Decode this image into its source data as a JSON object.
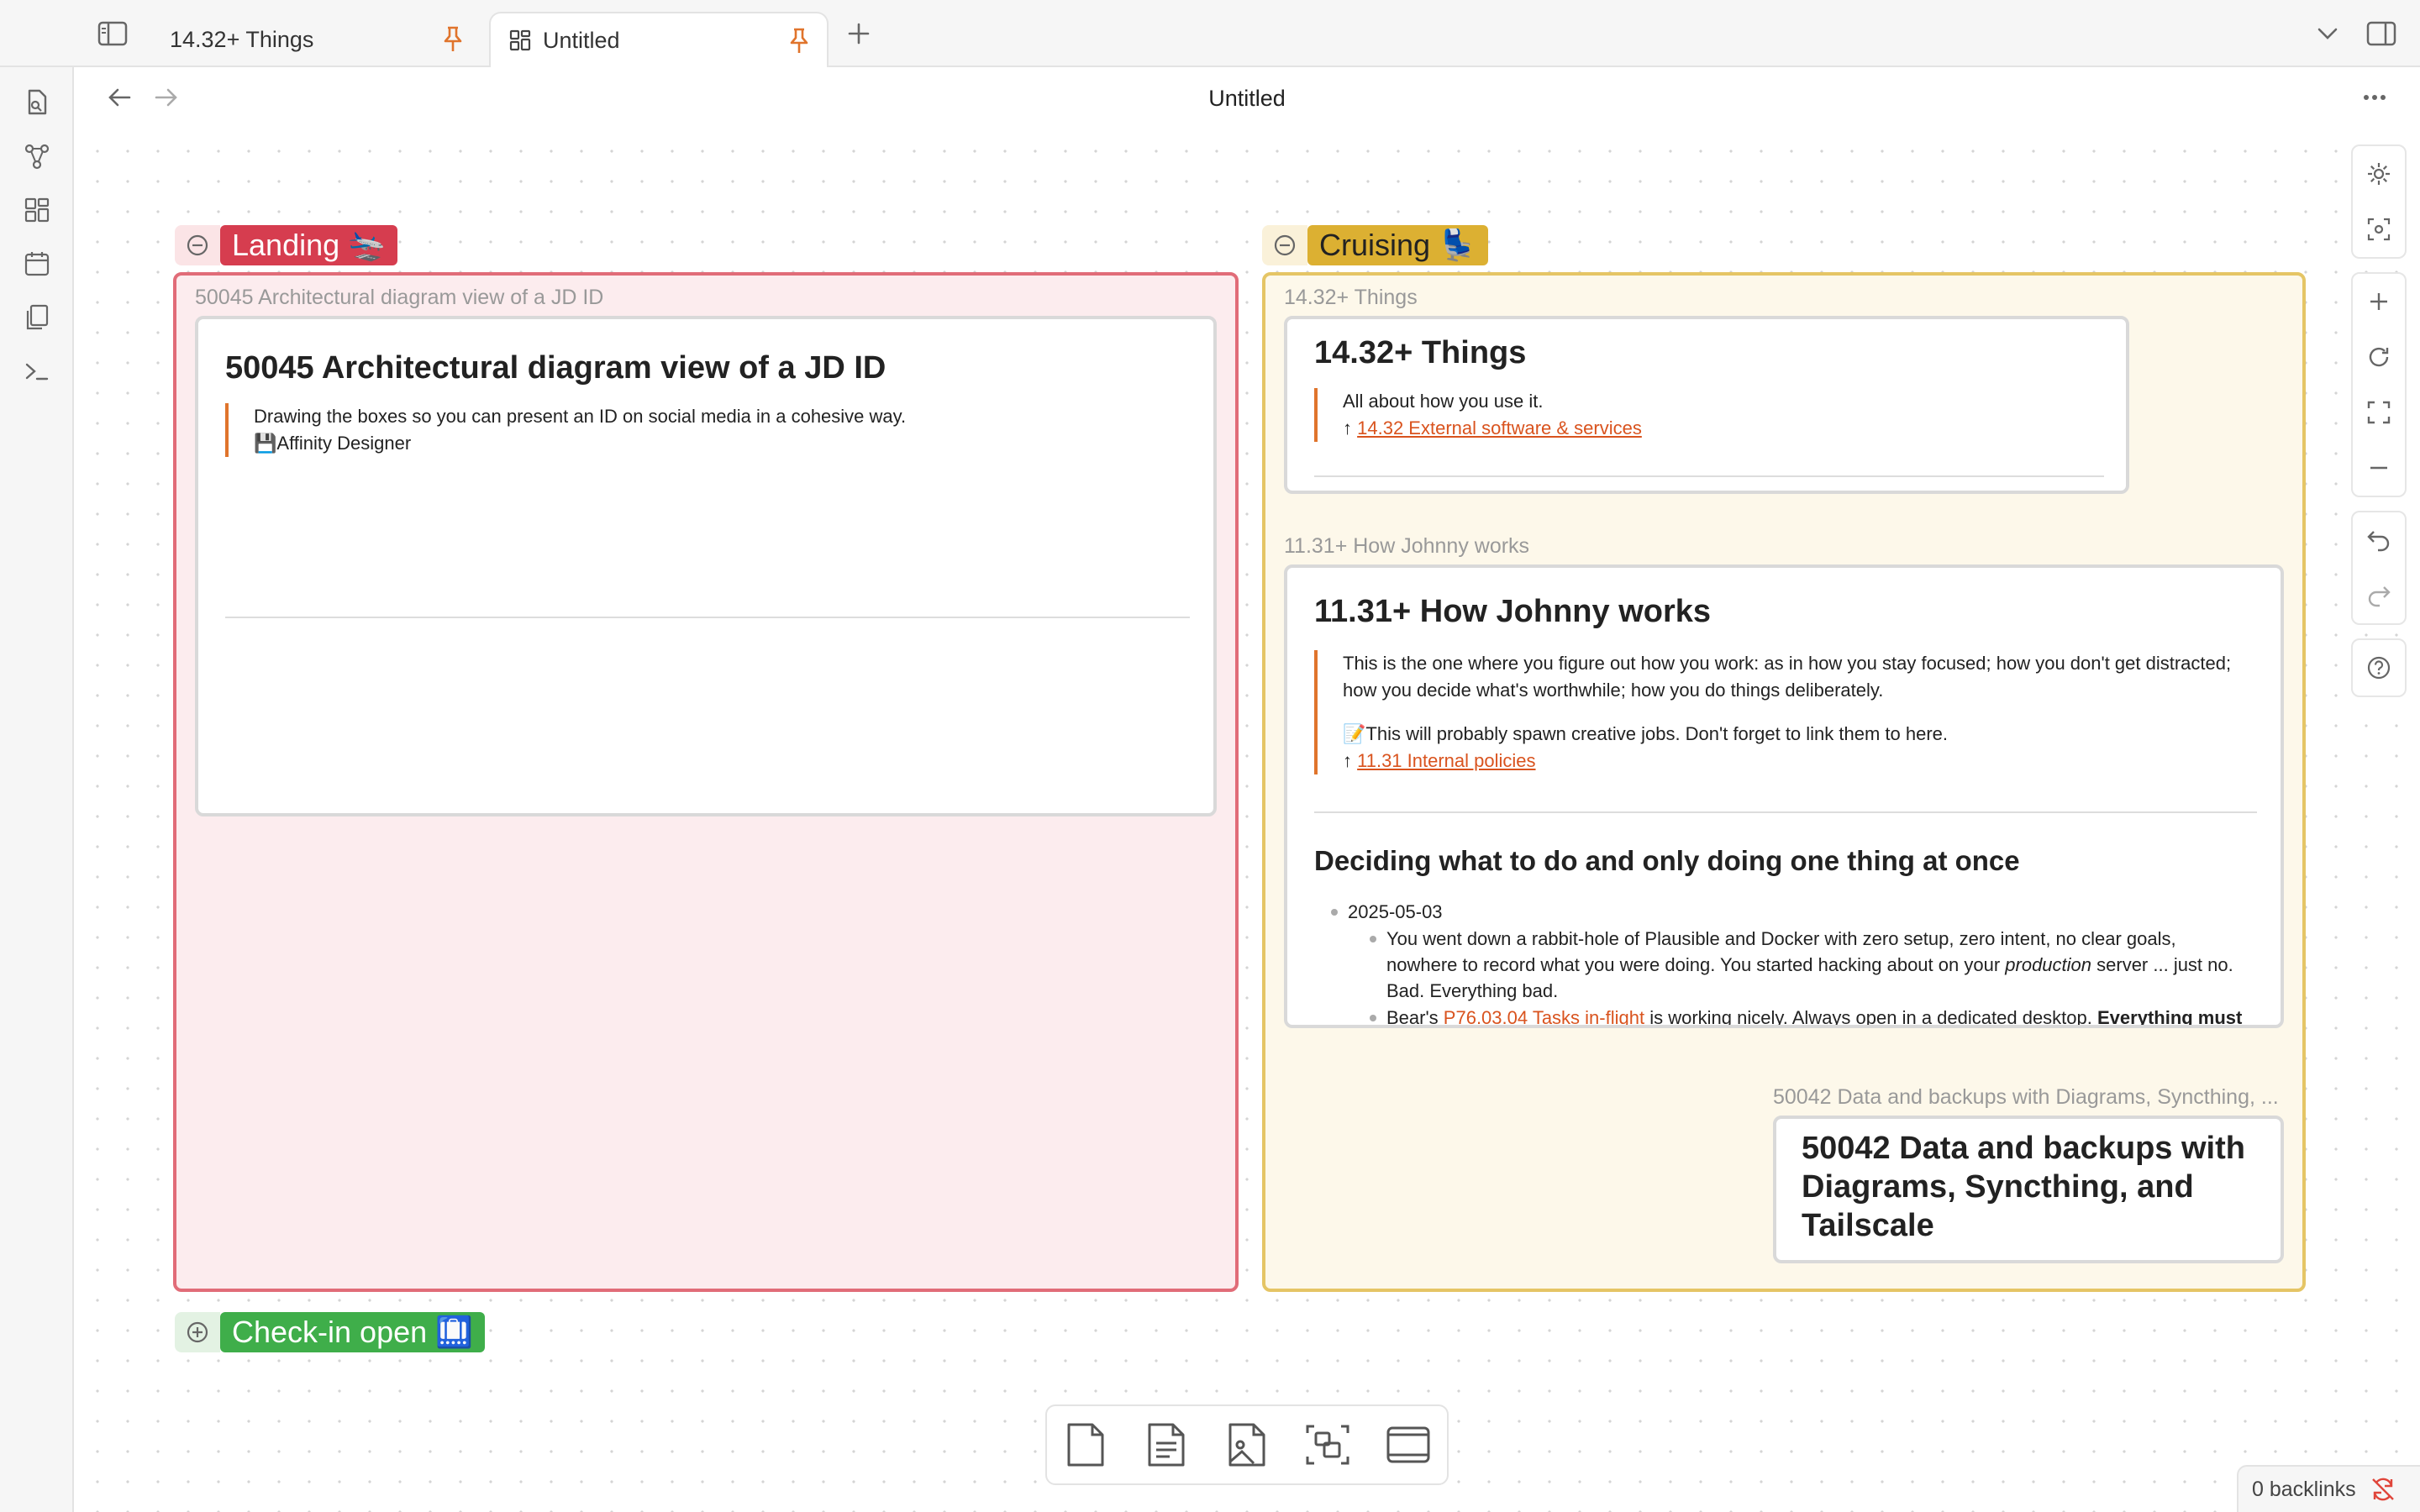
{
  "tabs": [
    {
      "label": "14.32+ Things",
      "active": false
    },
    {
      "label": "Untitled",
      "active": true
    }
  ],
  "navbar": {
    "title": "Untitled"
  },
  "groups": {
    "landing": {
      "label": "Landing 🛬",
      "color": "#d63d4f"
    },
    "cruising": {
      "label": "Cruising 💺",
      "color": "#dcb032"
    },
    "checkin": {
      "label": "Check-in open 🛄",
      "color": "#3fae4a"
    }
  },
  "nodes": {
    "n50045": {
      "file_title": "50045 Architectural diagram view of a JD ID",
      "heading": "50045 Architectural diagram view of a JD ID",
      "quote_line1": "Drawing the boxes so you can present an ID on social media in a cohesive way.",
      "quote_line2": "💾Affinity Designer"
    },
    "n1432": {
      "file_title": "14.32+ Things",
      "heading": "14.32+ Things",
      "quote_line1": "All about how you use it.",
      "arrow": "↑",
      "link": "14.32 External software & services"
    },
    "n1131": {
      "file_title": "11.31+ How Johnny works",
      "heading": "11.31+ How Johnny works",
      "quote_p1": "This is the one where you figure out how you work: as in how you stay focused; how you don't get distracted; how you decide what's worthwhile; how you do things deliberately.",
      "quote_p2": "📝This will probably spawn creative jobs. Don't forget to link them to here.",
      "arrow": "↑",
      "link": "11.31 Internal policies",
      "subheading": "Deciding what to do and only doing one thing at once",
      "date": "2025-05-03",
      "bullet1_a": "You went down a rabbit-hole of Plausible and Docker with zero setup, zero intent, no clear goals, nowhere to record what you were doing. You started hacking about on your ",
      "bullet1_em": "production",
      "bullet1_b": " server ... just no. Bad. Everything bad.",
      "bullet2_a": "Bear's ",
      "bullet2_link": "P76.03.04 Tasks in-flight",
      "bullet2_b": " is working nicely. Always open in a dedicated desktop. ",
      "bullet2_bold": "Everything must"
    },
    "n50042": {
      "file_title": "50042 Data and backups with Diagrams, Syncthing, ...",
      "heading": "50042 Data and backups with Diagrams, Syncthing, and Tailscale"
    }
  },
  "status": {
    "backlinks": "0 backlinks"
  },
  "icons": {
    "ribbon": [
      "file-search-icon",
      "graph-icon",
      "grid-icon",
      "calendar-icon",
      "copy-icon",
      "terminal-icon"
    ],
    "right_toolbar": [
      "settings-icon",
      "zoom-selection-icon",
      "zoom-in-icon",
      "reset-zoom-icon",
      "fit-icon",
      "zoom-out-icon",
      "undo-icon",
      "redo-icon",
      "help-icon"
    ],
    "bottom_toolbar": [
      "new-card-icon",
      "new-note-icon",
      "add-media-icon",
      "new-group-icon",
      "new-frame-icon"
    ]
  }
}
